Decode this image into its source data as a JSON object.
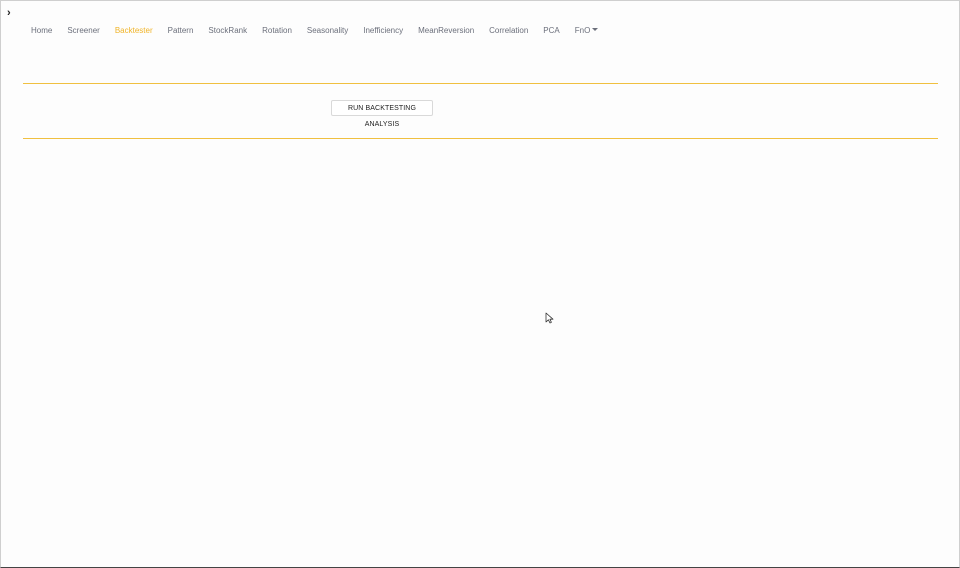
{
  "sidebar_toggle": {
    "glyph": "›"
  },
  "nav": {
    "items": [
      {
        "label": "Home"
      },
      {
        "label": "Screener"
      },
      {
        "label": "Backtester"
      },
      {
        "label": "Pattern"
      },
      {
        "label": "StockRank"
      },
      {
        "label": "Rotation"
      },
      {
        "label": "Seasonality"
      },
      {
        "label": "Inefficiency"
      },
      {
        "label": "MeanReversion"
      },
      {
        "label": "Correlation"
      },
      {
        "label": "PCA"
      },
      {
        "label": "FnO"
      }
    ],
    "active_index": 2,
    "active_color": "#f0b429",
    "fno_has_dropdown": true
  },
  "main": {
    "run_button_label": "RUN BACKTESTING ANALYSIS"
  },
  "colors": {
    "divider": "#f0c040",
    "nav_text": "#6b6f7b"
  }
}
